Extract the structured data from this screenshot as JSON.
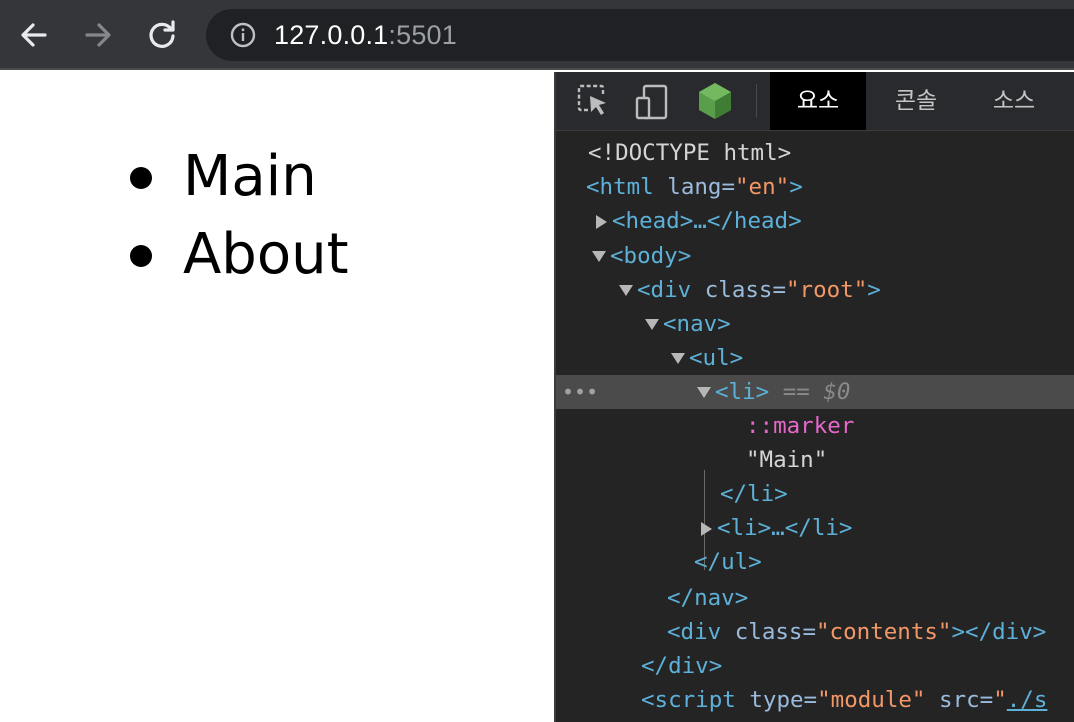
{
  "browser": {
    "nav": {
      "back_icon": "arrow-left-icon",
      "forward_icon": "arrow-right-icon",
      "reload_icon": "reload-icon"
    },
    "address_bar": {
      "host": "127.0.0.1",
      "port": ":5501",
      "info_icon": "info-icon"
    }
  },
  "page": {
    "nav_items": [
      {
        "label": "Main"
      },
      {
        "label": "About"
      }
    ]
  },
  "devtools": {
    "toolbar_icons": [
      "inspect-element-icon",
      "device-toolbar-icon",
      "node-icon"
    ],
    "tabs": [
      {
        "label": "요소",
        "active": true
      },
      {
        "label": "콘솔",
        "active": false
      },
      {
        "label": "소스",
        "active": false
      }
    ],
    "dom": {
      "doctype": "<!DOCTYPE html>",
      "html_open": "<html",
      "lang_attr": " lang=",
      "lang_val": "\"en\"",
      "html_close_bracket": ">",
      "head": "<head>…</head>",
      "body_open": "<body>",
      "div_open": "<div",
      "class_attr": " class=",
      "root_val": "\"root\"",
      "gt": ">",
      "nav_open": "<nav>",
      "ul_open": "<ul>",
      "li_open": "<li>",
      "selected_suffix": " == $0",
      "marker": "::marker",
      "main_text": "\"Main\"",
      "li_close": "</li>",
      "li_collapsed": "<li>…</li>",
      "ul_close": "</ul>",
      "nav_close": "</nav>",
      "contents_val": "\"contents\"",
      "div_selfclose": "></div>",
      "div_close": "</div>",
      "script_open": "<script",
      "type_attr": " type=",
      "module_val": "\"module\"",
      "src_attr": " src=",
      "src_val": "\"./s",
      "selection_dots": "•••"
    }
  }
}
